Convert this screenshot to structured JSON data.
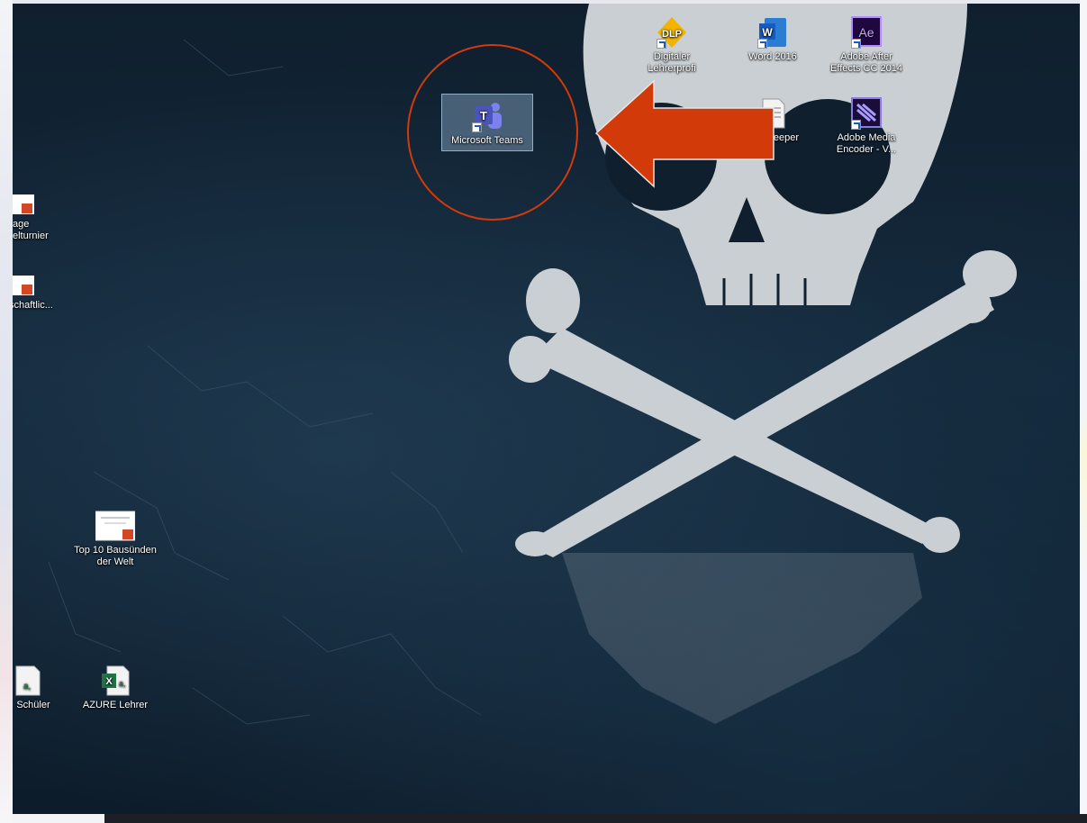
{
  "desktop": {
    "icons": [
      {
        "label": "Digitaler Lehrerprofi",
        "icon": "dlp-icon",
        "shortcut": true
      },
      {
        "label": "Word 2016",
        "icon": "word-icon",
        "shortcut": true
      },
      {
        "label": "Adobe After Effects CC 2014",
        "icon": "after-effects-icon",
        "shortcut": true
      },
      {
        "label": "Microsoft Teams",
        "icon": "teams-icon",
        "shortcut": true,
        "selected": true
      },
      {
        "label": "eeper",
        "icon": "document-icon",
        "shortcut": false
      },
      {
        "label": "Adobe Media Encoder - V...",
        "icon": "media-encoder-icon",
        "shortcut": true
      },
      {
        "label": "age\nelturnier",
        "icon": "powerpoint-icon",
        "shortcut": false
      },
      {
        "label": "schaftlic...",
        "icon": "powerpoint-icon",
        "shortcut": false
      },
      {
        "label": "Top 10 Bausünden der Welt",
        "icon": "powerpoint-icon",
        "shortcut": false
      },
      {
        "label": "Schüler",
        "icon": "excel-icon",
        "shortcut": false
      },
      {
        "label": "AZURE Lehrer",
        "icon": "excel-icon",
        "shortcut": false
      }
    ],
    "icon_glyphs": {
      "dlp": "DLP",
      "word": "W",
      "after_effects": "Ae",
      "teams": "T",
      "excel": "X",
      "excel_suffix": "a,"
    }
  },
  "annotation": {
    "shape": "circle-with-arrow",
    "color": "#d23a0a",
    "target": "Microsoft Teams"
  },
  "colors": {
    "wallpaper": "#13283a",
    "skull": "#c9cfd3",
    "selection": "#8caac8",
    "taskbar": "#1c2026"
  }
}
